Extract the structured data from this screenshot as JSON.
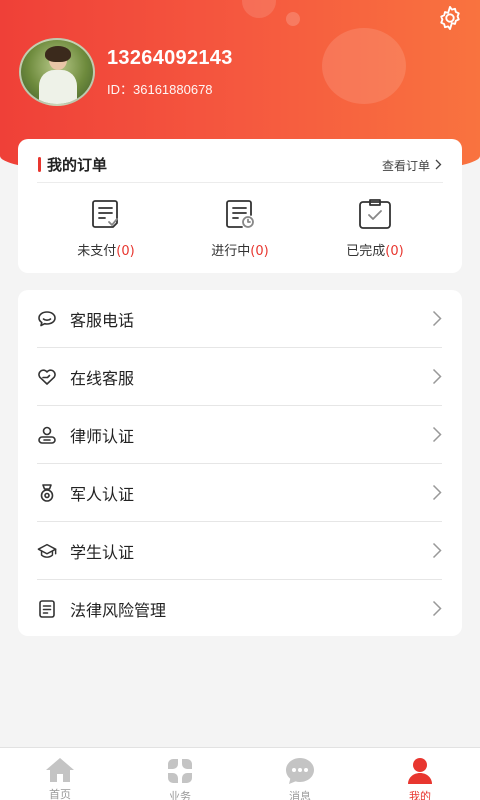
{
  "profile": {
    "phone": "13264092143",
    "id_label": "ID：36161880678"
  },
  "orders": {
    "title": "我的订单",
    "view_all": "查看订单",
    "items": [
      {
        "label": "未支付",
        "count": "(0)",
        "icon": "unpaid-doc-icon"
      },
      {
        "label": "进行中",
        "count": "(0)",
        "icon": "in-progress-doc-icon"
      },
      {
        "label": "已完成",
        "count": "(0)",
        "icon": "completed-clipboard-icon"
      }
    ]
  },
  "menu": {
    "items": [
      {
        "label": "客服电话",
        "icon": "chat-bubble-icon"
      },
      {
        "label": "在线客服",
        "icon": "heart-hand-icon"
      },
      {
        "label": "律师认证",
        "icon": "lawyer-icon"
      },
      {
        "label": "军人认证",
        "icon": "medal-icon"
      },
      {
        "label": "学生认证",
        "icon": "graduation-cap-icon"
      },
      {
        "label": "法律风险管理",
        "icon": "document-list-icon"
      }
    ]
  },
  "tabbar": {
    "items": [
      {
        "label": "首页",
        "icon": "home-icon",
        "active": false
      },
      {
        "label": "业务",
        "icon": "grid-petals-icon",
        "active": false
      },
      {
        "label": "消息",
        "icon": "message-icon",
        "active": false
      },
      {
        "label": "我的",
        "icon": "user-icon",
        "active": true
      }
    ]
  },
  "colors": {
    "accent": "#e8362f",
    "header_gradient_start": "#ef4038",
    "header_gradient_end": "#f9733f",
    "tab_inactive": "#c4c4c4"
  }
}
